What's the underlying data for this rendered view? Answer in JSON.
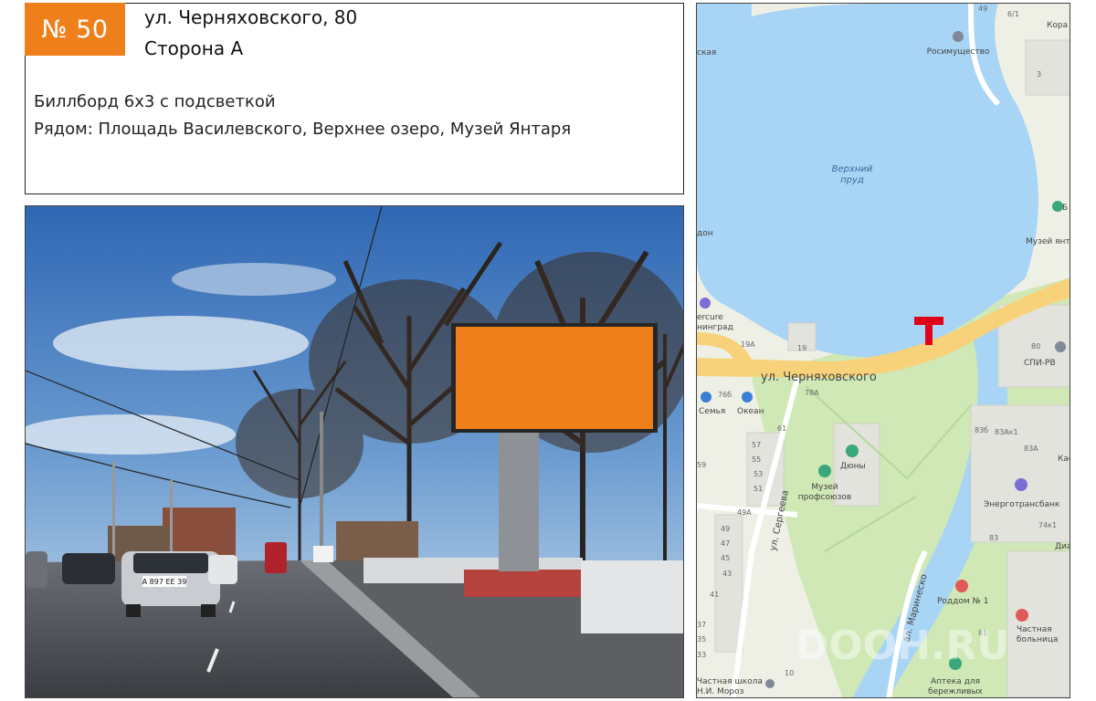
{
  "header": {
    "number_badge": "№ 50",
    "address": "ул. Черняховского, 80",
    "side": "Сторона А"
  },
  "description": {
    "type": "Биллборд 6х3 с подсветкой",
    "nearby": "Рядом: Площадь Василевского, Верхнее озеро, Музей Янтаря"
  },
  "photo": {
    "plate": "А 897 ЕЕ 39"
  },
  "map": {
    "lake_name_1": "Верхний",
    "lake_name_2": "пруд",
    "street_main": "ул. Черняховского",
    "street_sergeeva": "ул. Сергеева",
    "street_marinesko": "ал. Маринеско",
    "poi_rosimushchestvo": "Росимущество",
    "poi_muzey_yantarya": "Музей янта",
    "poi_mercure_1": "ercure",
    "poi_mercure_2": "нинград",
    "poi_semya": "Семья",
    "poi_okean": "Океан",
    "poi_dyuny": "Дюны",
    "poi_muzey_prof_1": "Музей",
    "poi_muzey_prof_2": "профсоюзов",
    "poi_energotransbank": "Энерготрансбанк",
    "poi_roddom": "Роддом № 1",
    "poi_chastnaya_bolnitsa_1": "Частная",
    "poi_chastnaya_bolnitsa_2": "больница",
    "poi_apteka_1": "Аптека для",
    "poi_apteka_2": "бережливых",
    "poi_school_1": "Частная школа",
    "poi_school_2": "Н.И. Мороз",
    "poi_spi": "СПИ-РВ",
    "poi_kora": "Кора",
    "poi_don": "дон",
    "poi_kas": "Кас",
    "poi_dia": "Диа",
    "poi_aya": "ская",
    "poi_b": "Б",
    "house_80": "80",
    "house_19": "19",
    "house_19a": "19А",
    "house_76b": "76б",
    "house_78a": "78А",
    "house_61": "61",
    "house_57": "57",
    "house_55": "55",
    "house_53": "53",
    "house_51": "51",
    "house_49a": "49А",
    "house_49": "49",
    "house_47": "47",
    "house_45": "45",
    "house_43": "43",
    "house_41": "41",
    "house_59": "59",
    "house_83b": "83б",
    "house_83ak1": "83Ак1",
    "house_83a": "83А",
    "house_83": "83",
    "house_81": "81",
    "house_74k1": "74к1",
    "house_6_1": "6/1",
    "house_3": "3",
    "house_10": "10",
    "house_33": "33",
    "house_35": "35",
    "house_37": "37",
    "house_49_top": "49",
    "watermark": "DOOH.RU"
  },
  "colors": {
    "accent_orange": "#ef7f1a",
    "marker_red": "#e0001a",
    "water_blue": "#a8d4f5",
    "road_yellow": "#f7d27a"
  }
}
